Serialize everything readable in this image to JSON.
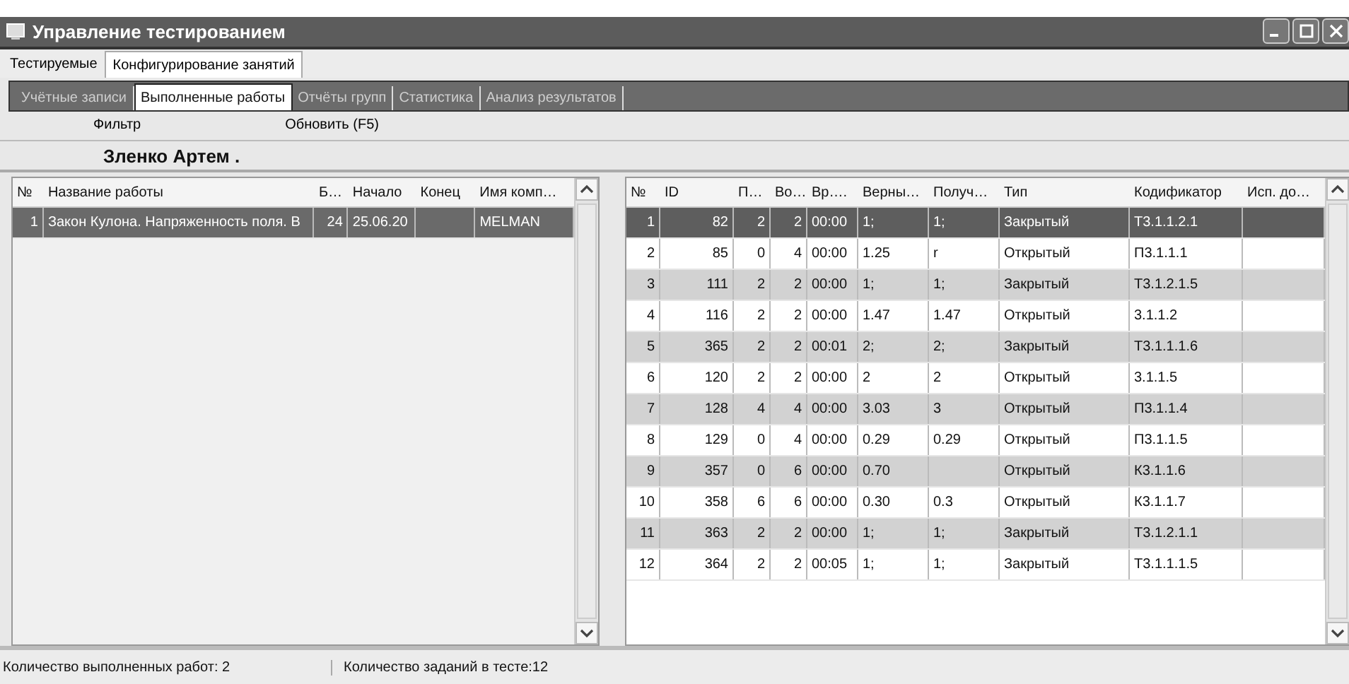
{
  "window": {
    "title": "Управление тестированием"
  },
  "tabs": [
    {
      "label": "Тестируемые",
      "selected": false
    },
    {
      "label": "Конфигурирование занятий",
      "selected": true
    }
  ],
  "subtabs": [
    {
      "label": "Учётные записи",
      "selected": false
    },
    {
      "label": "Выполненные работы",
      "selected": true
    },
    {
      "label": "Отчёты групп",
      "selected": false
    },
    {
      "label": "Статистика",
      "selected": false
    },
    {
      "label": "Анализ результатов",
      "selected": false
    }
  ],
  "toolbar": [
    "Фильтр",
    "Обновить (F5)"
  ],
  "student_name": "Зленко Артем .",
  "works_table": {
    "columns": [
      "№",
      "Название работы",
      "Б…",
      "Начало",
      "Конец",
      "Имя комп…"
    ],
    "rows": [
      {
        "selected": true,
        "cells": [
          "1",
          "Закон Кулона. Напряженность поля. В",
          "24",
          "25.06.20",
          null,
          "MELMAN"
        ]
      }
    ]
  },
  "tasks_table": {
    "columns": [
      "№",
      "ID",
      "П…",
      "Во…",
      "Вр….",
      "Верны…",
      "Получ…",
      "Тип",
      "Кодификатор",
      "Исп. до…"
    ],
    "rows": [
      {
        "selected": true,
        "cells": [
          "1",
          "82",
          "2",
          "2",
          "00:00",
          "1;",
          "1;",
          "Закрытый",
          "Т3.1.1.2.1",
          null
        ]
      },
      {
        "selected": false,
        "cells": [
          "2",
          "85",
          "0",
          "4",
          "00:00",
          "1.25",
          "r",
          "Открытый",
          "П3.1.1.1",
          null
        ]
      },
      {
        "selected": false,
        "cells": [
          "3",
          "111",
          "2",
          "2",
          "00:00",
          "1;",
          "1;",
          "Закрытый",
          "Т3.1.2.1.5",
          null
        ]
      },
      {
        "selected": false,
        "cells": [
          "4",
          "116",
          "2",
          "2",
          "00:00",
          "1.47",
          "1.47",
          "Открытый",
          "3.1.1.2",
          null
        ]
      },
      {
        "selected": false,
        "cells": [
          "5",
          "365",
          "2",
          "2",
          "00:01",
          "2;",
          "2;",
          "Закрытый",
          "Т3.1.1.1.6",
          null
        ]
      },
      {
        "selected": false,
        "cells": [
          "6",
          "120",
          "2",
          "2",
          "00:00",
          "2",
          "2",
          "Открытый",
          "3.1.1.5",
          null
        ]
      },
      {
        "selected": false,
        "cells": [
          "7",
          "128",
          "4",
          "4",
          "00:00",
          "3.03",
          "3",
          "Открытый",
          "П3.1.1.4",
          null
        ]
      },
      {
        "selected": false,
        "cells": [
          "8",
          "129",
          "0",
          "4",
          "00:00",
          "0.29",
          "0.29",
          "Открытый",
          "П3.1.1.5",
          null
        ]
      },
      {
        "selected": false,
        "cells": [
          "9",
          "357",
          "0",
          "6",
          "00:00",
          "0.70",
          null,
          "Открытый",
          "К3.1.1.6",
          null
        ]
      },
      {
        "selected": false,
        "cells": [
          "10",
          "358",
          "6",
          "6",
          "00:00",
          "0.30",
          "0.3",
          "Открытый",
          "К3.1.1.7",
          null
        ]
      },
      {
        "selected": false,
        "cells": [
          "11",
          "363",
          "2",
          "2",
          "00:00",
          "1;",
          "1;",
          "Закрытый",
          "Т3.1.2.1.1",
          null
        ]
      },
      {
        "selected": false,
        "cells": [
          "12",
          "364",
          "2",
          "2",
          "00:05",
          "1;",
          "1;",
          "Закрытый",
          "Т3.1.1.1.5",
          null
        ]
      }
    ]
  },
  "status_bar": [
    "Количество выполненных работ: 2",
    "Количество заданий в тесте:12"
  ]
}
